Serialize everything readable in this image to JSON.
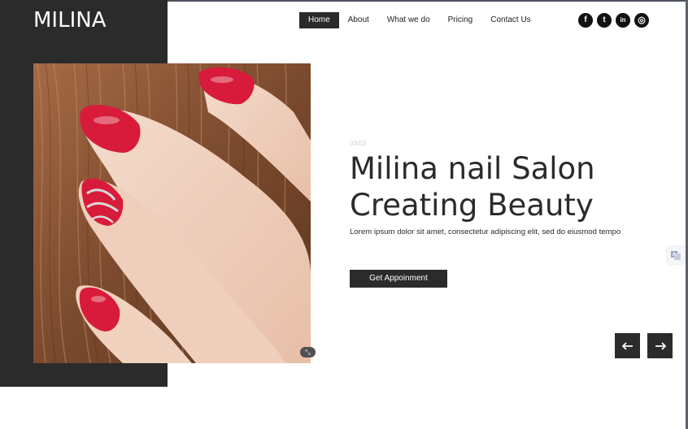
{
  "brand": {
    "logo": "MILINA"
  },
  "nav": {
    "items": [
      {
        "label": "Home",
        "active": true
      },
      {
        "label": "About",
        "active": false
      },
      {
        "label": "What we do",
        "active": false
      },
      {
        "label": "Pricing",
        "active": false
      },
      {
        "label": "Contact Us",
        "active": false
      }
    ]
  },
  "social": [
    {
      "icon": "facebook-icon",
      "glyph": "f"
    },
    {
      "icon": "twitter-icon",
      "glyph": "t"
    },
    {
      "icon": "linkedin-icon",
      "glyph": "in"
    },
    {
      "icon": "instagram-icon",
      "glyph": "◎"
    }
  ],
  "hero": {
    "counter": "03/03",
    "title_line1": "Milina nail Salon",
    "title_line2": "Creating Beauty",
    "text": "Lorem ipsum dolor sit amet, consectetur adipiscing elit, sed do eiusmod tempo",
    "cta_label": "Get Appoinment",
    "photo_badge": "⤡"
  },
  "slider": {
    "prev_icon": "arrow-left-icon",
    "next_icon": "arrow-right-icon"
  },
  "colors": {
    "dark": "#2b2b2b",
    "white": "#ffffff",
    "nail_red": "#d81b3a"
  }
}
